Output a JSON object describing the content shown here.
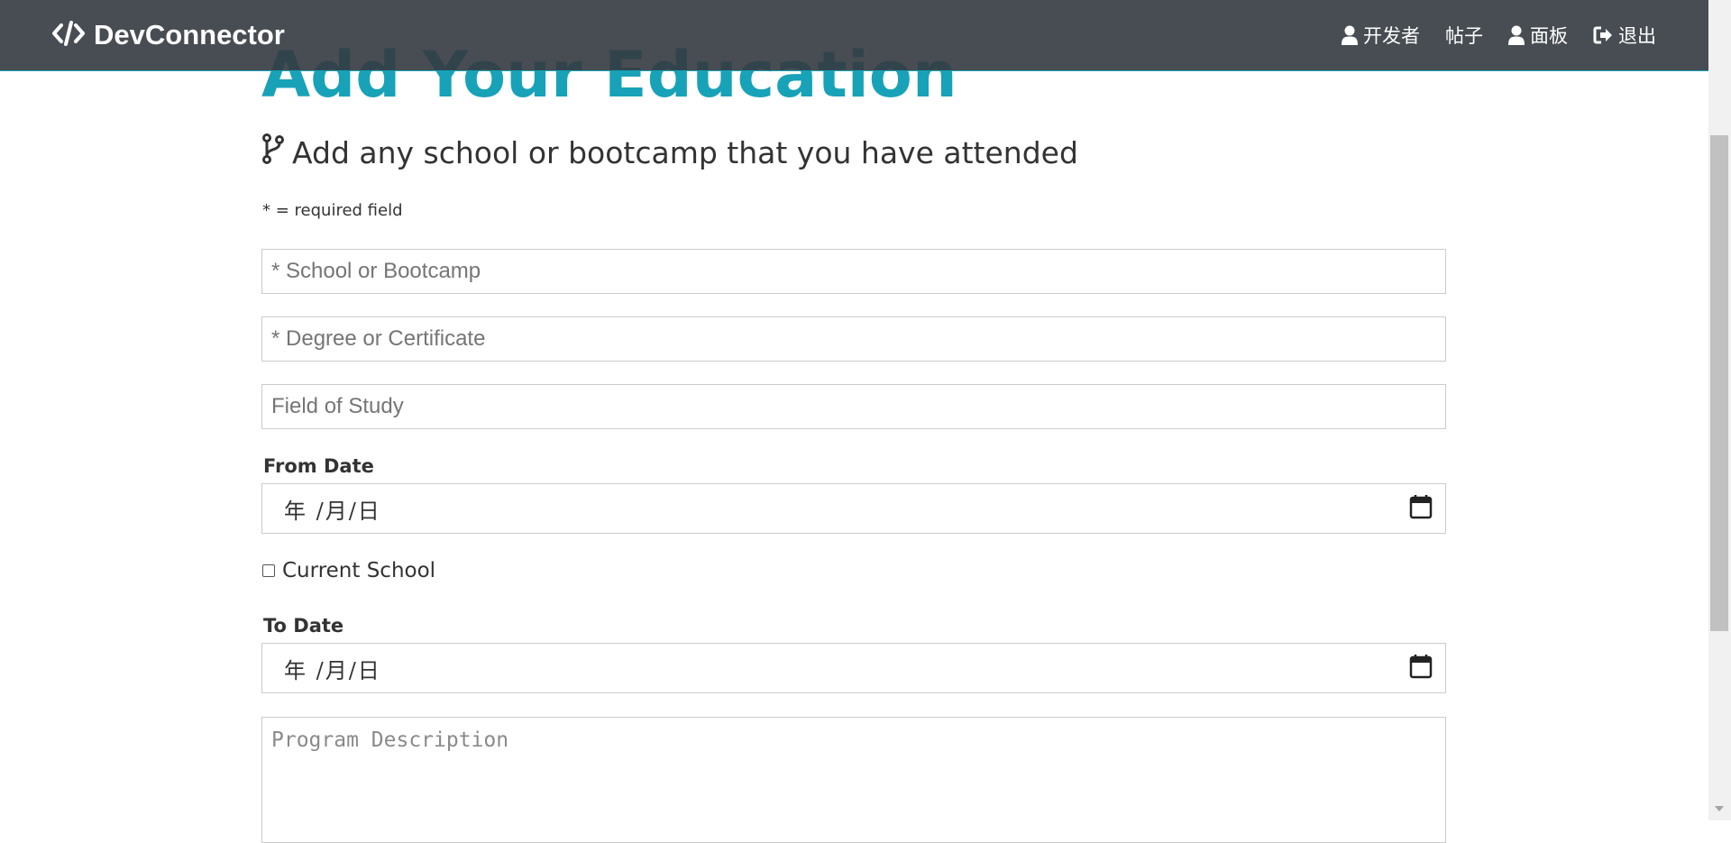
{
  "navbar": {
    "brand": "DevConnector",
    "links": [
      {
        "label": "开发者",
        "icon": "user-icon"
      },
      {
        "label": "帖子",
        "icon": ""
      },
      {
        "label": "面板",
        "icon": "user-icon"
      },
      {
        "label": "退出",
        "icon": "sign-out-icon"
      }
    ]
  },
  "page": {
    "title": "Add Your Education",
    "lead": "Add any school or bootcamp that you have attended",
    "lead_icon": "code-branch-icon",
    "required_note": "* = required field"
  },
  "form": {
    "school": {
      "placeholder": "* School or Bootcamp",
      "value": ""
    },
    "degree": {
      "placeholder": "* Degree or Certificate",
      "value": ""
    },
    "field_of_study": {
      "placeholder": "Field of Study",
      "value": ""
    },
    "from_date": {
      "label": "From Date",
      "display": "年 /月/日"
    },
    "current_school": {
      "label": "Current School",
      "checked": false
    },
    "to_date": {
      "label": "To Date",
      "display": "年 /月/日"
    },
    "description": {
      "placeholder": "Program Description",
      "value": ""
    }
  },
  "colors": {
    "navbar_bg": "#4a4f55",
    "accent": "#17a2b8",
    "text": "#333333",
    "input_border": "#cccccc"
  }
}
